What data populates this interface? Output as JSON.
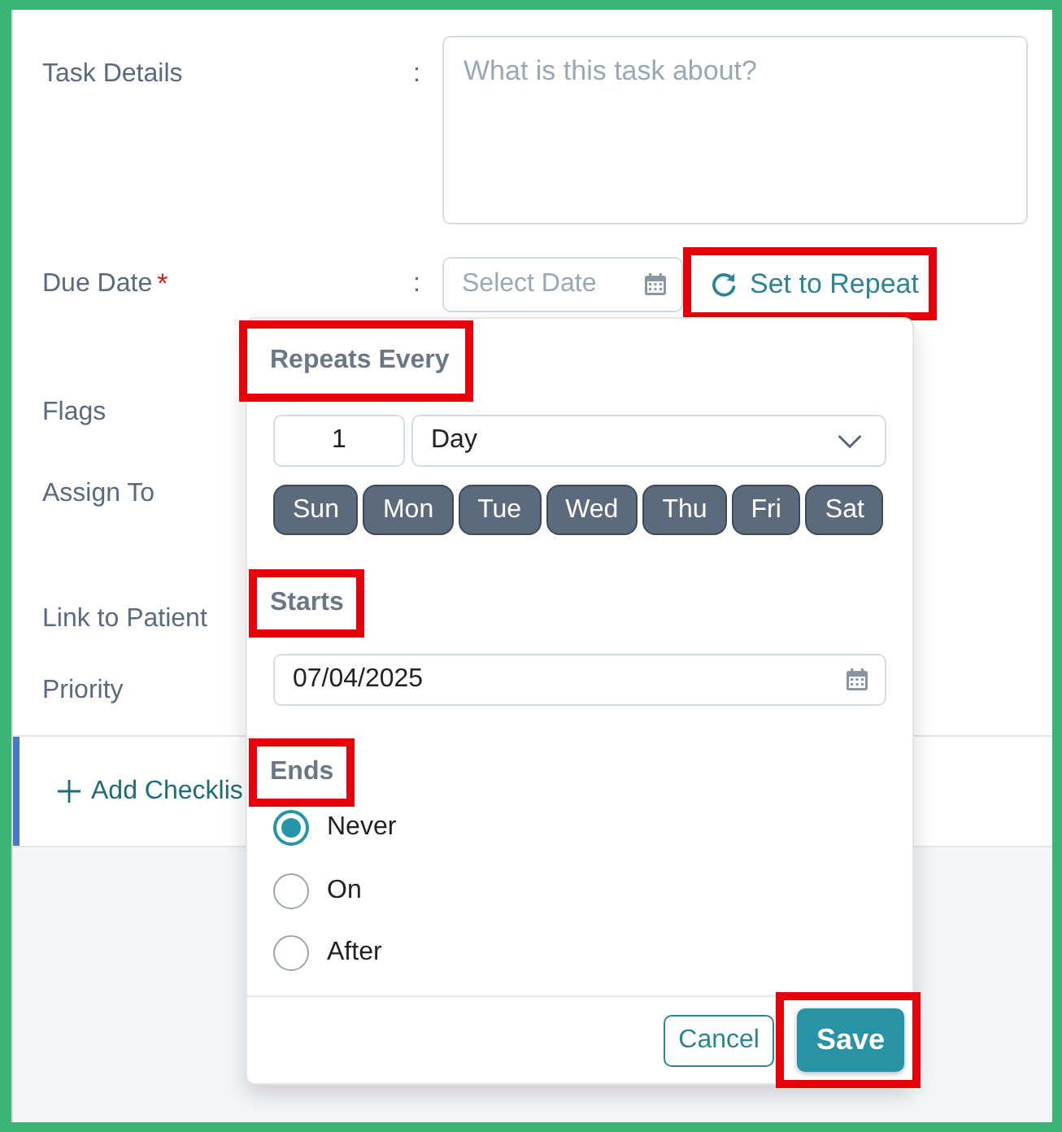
{
  "form": {
    "fields": [
      {
        "label": "Task Details",
        "separator": ":",
        "kind": "textarea",
        "placeholder": "What is this task about?"
      },
      {
        "label": "Due Date",
        "required_mark": "*",
        "separator": ":",
        "kind": "date",
        "placeholder": "Select Date",
        "action": {
          "label": "Set to Repeat",
          "highlighted": true
        }
      },
      {
        "label": "Flags"
      },
      {
        "label": "Assign To"
      },
      {
        "label": "Link to Patient"
      },
      {
        "label": "Priority"
      }
    ]
  },
  "checklist": {
    "label": "Add Checklis"
  },
  "repeat_popup": {
    "sections": [
      {
        "kind": "interval",
        "heading": "Repeats Every",
        "highlighted": true,
        "interval": "1",
        "unit": "Day",
        "days": [
          {
            "label": "Sun",
            "selected": false
          },
          {
            "label": "Mon",
            "selected": false
          },
          {
            "label": "Tue",
            "selected": false
          },
          {
            "label": "Wed",
            "selected": false
          },
          {
            "label": "Thu",
            "selected": false
          },
          {
            "label": "Fri",
            "selected": false
          },
          {
            "label": "Sat",
            "selected": false
          }
        ]
      },
      {
        "kind": "start",
        "heading": "Starts",
        "highlighted": true,
        "date": "07/04/2025"
      },
      {
        "kind": "end",
        "heading": "Ends",
        "highlighted": true,
        "options": [
          {
            "label": "Never",
            "selected": true
          },
          {
            "label": "On",
            "selected": false
          },
          {
            "label": "After",
            "selected": false
          }
        ]
      }
    ],
    "buttons": [
      {
        "kind": "secondary",
        "label": "Cancel",
        "highlighted": false
      },
      {
        "kind": "primary",
        "label": "Save",
        "highlighted": true
      }
    ]
  }
}
